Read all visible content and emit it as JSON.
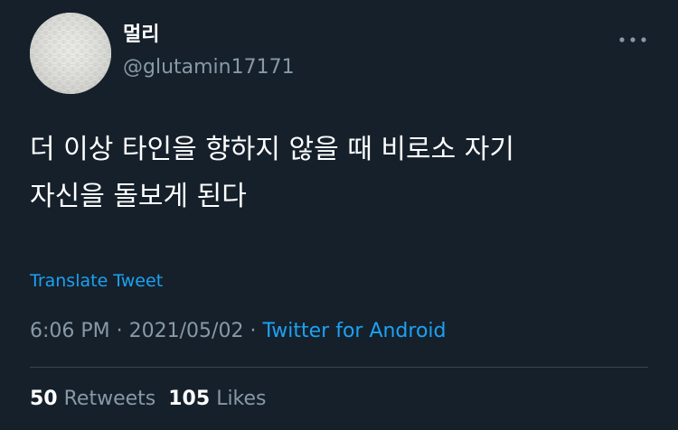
{
  "author": {
    "display_name": "멀리",
    "handle": "@glutamin17171",
    "avatar_icon": "avatar-image"
  },
  "more_icon": "more-horizontal-icon",
  "tweet": {
    "text": "더 이상 타인을 향하지 않을 때 비로소 자기\n자신을 돌보게 된다",
    "translate_label": "Translate Tweet"
  },
  "meta": {
    "time": "6:06 PM",
    "separator": "·",
    "date": "2021/05/02",
    "source": "Twitter for Android"
  },
  "stats": {
    "retweets_count": "50",
    "retweets_label": "Retweets",
    "likes_count": "105",
    "likes_label": "Likes"
  },
  "colors": {
    "background": "#15202b",
    "primary_text": "#ffffff",
    "secondary_text": "#8899a6",
    "accent": "#1da1f2",
    "divider": "#38444d"
  }
}
